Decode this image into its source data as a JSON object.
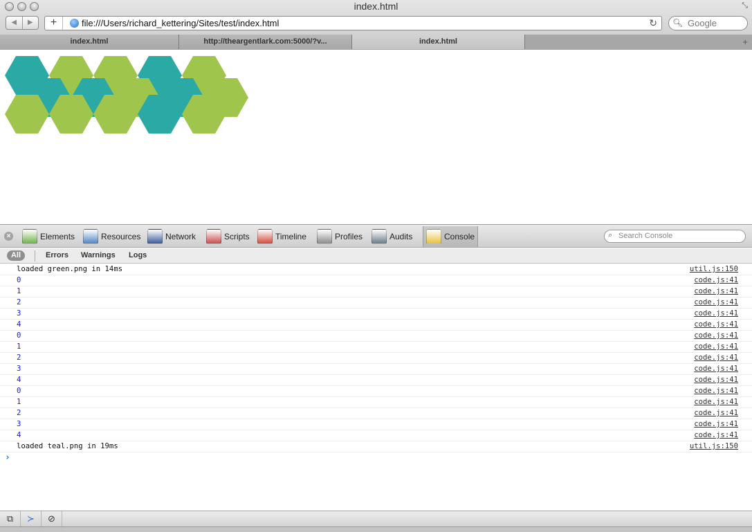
{
  "window": {
    "title": "index.html"
  },
  "toolbar": {
    "back_icon": "back-arrow-icon",
    "forward_icon": "forward-arrow-icon",
    "add_label": "+",
    "url": "file:///Users/richard_kettering/Sites/test/index.html",
    "reload_icon": "reload-icon",
    "search_placeholder": "Google"
  },
  "tabs": [
    {
      "label": "index.html"
    },
    {
      "label": "http://theargentlark.com:5000/?v..."
    },
    {
      "label": "index.html"
    }
  ],
  "hexagons": {
    "colors": {
      "teal": "#2aa9a5",
      "green": "#9fc54c"
    }
  },
  "devtools": {
    "panels": [
      {
        "label": "Elements",
        "icon": "elements-icon",
        "color": "#6fb04a"
      },
      {
        "label": "Resources",
        "icon": "resources-icon",
        "color": "#4f84c4"
      },
      {
        "label": "Network",
        "icon": "network-icon",
        "color": "#3a5a9a"
      },
      {
        "label": "Scripts",
        "icon": "scripts-icon",
        "color": "#c94b4b"
      },
      {
        "label": "Timeline",
        "icon": "timeline-icon",
        "color": "#d24b3a"
      },
      {
        "label": "Profiles",
        "icon": "profiles-icon",
        "color": "#8a8a8a"
      },
      {
        "label": "Audits",
        "icon": "audits-icon",
        "color": "#6a7a8a"
      },
      {
        "label": "Console",
        "icon": "console-icon",
        "color": "#e8c23a"
      }
    ],
    "search_placeholder": "Search Console",
    "filters": {
      "all": "All",
      "errors": "Errors",
      "warnings": "Warnings",
      "logs": "Logs"
    },
    "console_rows": [
      {
        "msg": "loaded green.png in 14ms",
        "src": "util.js:150",
        "numeric": false
      },
      {
        "msg": "0",
        "src": "code.js:41",
        "numeric": true
      },
      {
        "msg": "1",
        "src": "code.js:41",
        "numeric": true
      },
      {
        "msg": "2",
        "src": "code.js:41",
        "numeric": true
      },
      {
        "msg": "3",
        "src": "code.js:41",
        "numeric": true
      },
      {
        "msg": "4",
        "src": "code.js:41",
        "numeric": true
      },
      {
        "msg": "0",
        "src": "code.js:41",
        "numeric": true
      },
      {
        "msg": "1",
        "src": "code.js:41",
        "numeric": true
      },
      {
        "msg": "2",
        "src": "code.js:41",
        "numeric": true
      },
      {
        "msg": "3",
        "src": "code.js:41",
        "numeric": true
      },
      {
        "msg": "4",
        "src": "code.js:41",
        "numeric": true
      },
      {
        "msg": "0",
        "src": "code.js:41",
        "numeric": true
      },
      {
        "msg": "1",
        "src": "code.js:41",
        "numeric": true
      },
      {
        "msg": "2",
        "src": "code.js:41",
        "numeric": true
      },
      {
        "msg": "3",
        "src": "code.js:41",
        "numeric": true
      },
      {
        "msg": "4",
        "src": "code.js:41",
        "numeric": true
      },
      {
        "msg": "loaded teal.png in 19ms",
        "src": "util.js:150",
        "numeric": false
      }
    ],
    "prompt_symbol": "›",
    "status_icons": [
      "dock-icon",
      "console-toggle-icon",
      "clear-console-icon"
    ]
  }
}
